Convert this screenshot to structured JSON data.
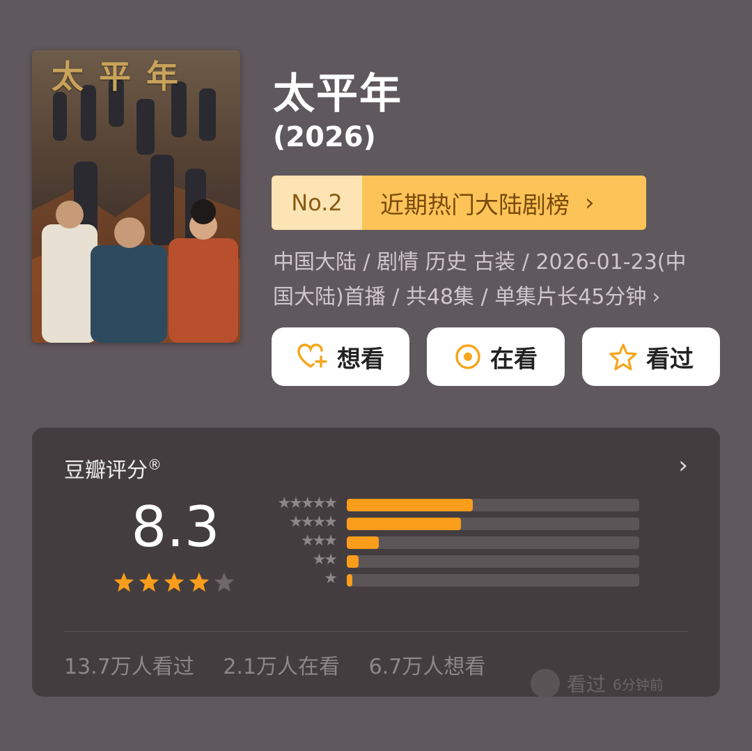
{
  "poster": {
    "title_art": "太平年",
    "icon": "poster-image"
  },
  "title": "太平年",
  "year": "(2026)",
  "ranking": {
    "rank": "No.2",
    "label": "近期热门大陆剧榜",
    "chevron": "›"
  },
  "meta": {
    "line1": "中国大陆 / 剧情 历史 古装 / 2026-01-23(中",
    "line2": "国大陆)首播 / 共48集 / 单集片长45分钟",
    "chevron": "›"
  },
  "actions": [
    {
      "label": "想看",
      "icon": "heart-plus-icon"
    },
    {
      "label": "在看",
      "icon": "target-circle-icon"
    },
    {
      "label": "看过",
      "icon": "star-outline-icon"
    }
  ],
  "rating": {
    "title": "豆瓣评分",
    "registered": "®",
    "chevron": "›",
    "score": "8.3",
    "stars_filled": 4,
    "stars_total": 5,
    "distribution": [
      {
        "stars": 5,
        "fraction": 0.43
      },
      {
        "stars": 4,
        "fraction": 0.39
      },
      {
        "stars": 3,
        "fraction": 0.11
      },
      {
        "stars": 2,
        "fraction": 0.04
      },
      {
        "stars": 1,
        "fraction": 0.02
      }
    ],
    "stats": [
      "13.7万人看过",
      "2.1万人在看",
      "6.7万人想看"
    ]
  },
  "watermark": {
    "label": "看过",
    "sub": "6分钟前"
  },
  "colors": {
    "background": "#5f585c",
    "card": "#433d40",
    "accent": "#f99d1b",
    "rank_bg": "#fcc458"
  }
}
